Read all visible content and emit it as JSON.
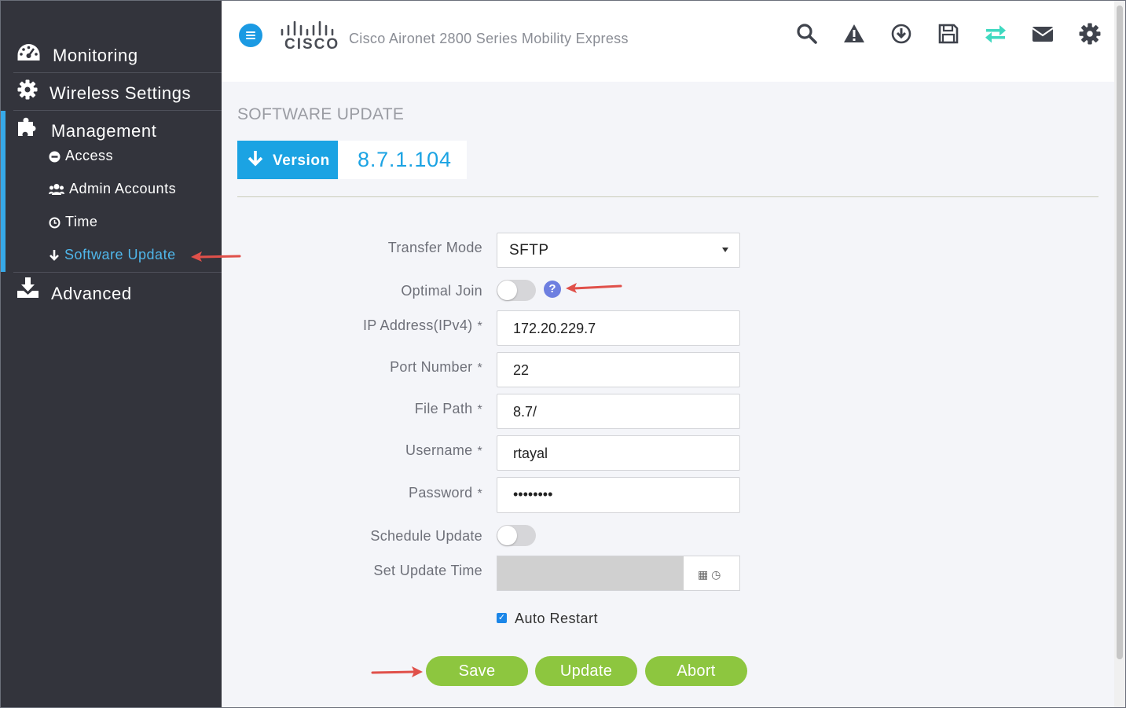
{
  "sidebar": {
    "items": [
      {
        "label": "Monitoring",
        "icon": "dashboard-icon"
      },
      {
        "label": "Wireless Settings",
        "icon": "gear-icon"
      },
      {
        "label": "Management",
        "icon": "puzzle-icon"
      },
      {
        "label": "Advanced",
        "icon": "download-tray-icon"
      }
    ],
    "management_sub": [
      {
        "label": "Access",
        "icon": "minus-circle-icon"
      },
      {
        "label": "Admin Accounts",
        "icon": "users-icon"
      },
      {
        "label": "Time",
        "icon": "clock-icon"
      },
      {
        "label": "Software Update",
        "icon": "arrow-down-icon"
      }
    ]
  },
  "header": {
    "logo_word": "CISCO",
    "product": "Cisco Aironet 2800 Series Mobility Express",
    "icons": [
      "search-icon",
      "alert-icon",
      "download-circle-icon",
      "save-icon",
      "transfer-icon",
      "mail-icon",
      "gear-icon"
    ]
  },
  "page": {
    "title": "SOFTWARE UPDATE",
    "version_label": "Version",
    "version_value": "8.7.1.104"
  },
  "form": {
    "transfer_mode": {
      "label": "Transfer Mode",
      "value": "SFTP"
    },
    "optimal_join": {
      "label": "Optimal Join",
      "help": "?"
    },
    "ip_address": {
      "label": "IP Address(IPv4)",
      "required": "*",
      "value": "172.20.229.7"
    },
    "port_number": {
      "label": "Port Number",
      "required": "*",
      "value": "22"
    },
    "file_path": {
      "label": "File Path",
      "required": "*",
      "value": "8.7/"
    },
    "username": {
      "label": "Username",
      "required": "*",
      "value": "rtayal"
    },
    "password": {
      "label": "Password",
      "required": "*",
      "value": "••••••••"
    },
    "schedule_update": {
      "label": "Schedule Update"
    },
    "set_update_time": {
      "label": "Set Update Time",
      "addon": "▦ ◷"
    },
    "auto_restart": {
      "label": "Auto Restart",
      "checked": true
    }
  },
  "buttons": {
    "save": "Save",
    "update": "Update",
    "abort": "Abort"
  },
  "colors": {
    "sidebar": "#33343c",
    "accent": "#1ba3e3",
    "button": "#8dc63f",
    "annotation_arrow": "#e0504a"
  }
}
